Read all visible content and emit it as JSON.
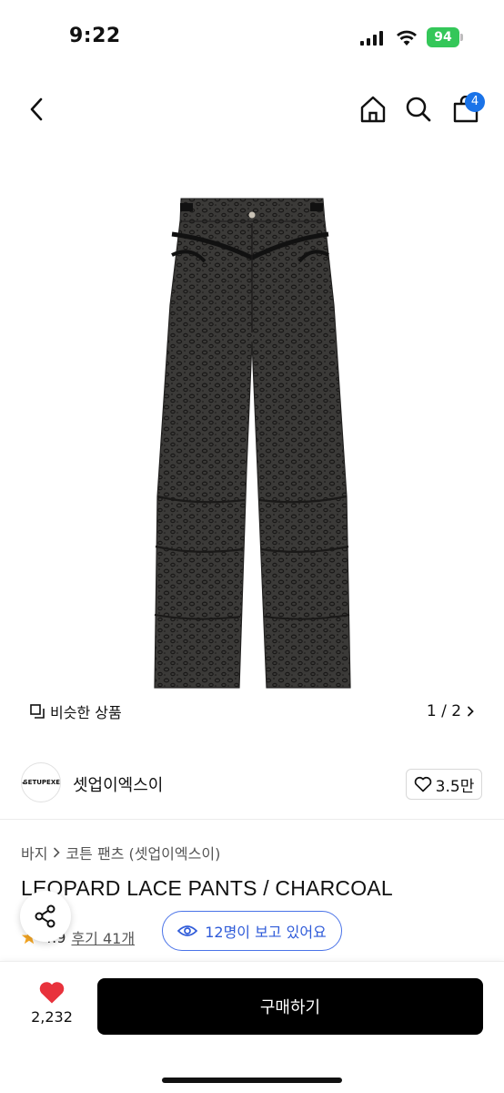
{
  "status_bar": {
    "time": "9:22",
    "battery": "94"
  },
  "nav": {
    "cart_count": "4"
  },
  "gallery": {
    "similar_label": "비슷한 상품",
    "page_indicator": "1 / 2"
  },
  "brand": {
    "logo_text": "SETUPEXE",
    "name": "셋업이엑스이",
    "likes": "3.5만"
  },
  "breadcrumb": {
    "category": "바지",
    "subcategory": "코튼 팬츠 (셋업이엑스이)"
  },
  "product": {
    "title": "LEOPARD LACE PANTS / CHARCOAL",
    "rating": "4.9",
    "review_label": "후기 41개",
    "viewers_label": "12명이 보고 있어요"
  },
  "bottom_bar": {
    "wish_count": "2,232",
    "buy_label": "구매하기"
  },
  "colors": {
    "accent": "#1a73e8",
    "viewer_blue": "#2f5bd9",
    "heart": "#e8323c",
    "buy_button": "#000000"
  }
}
